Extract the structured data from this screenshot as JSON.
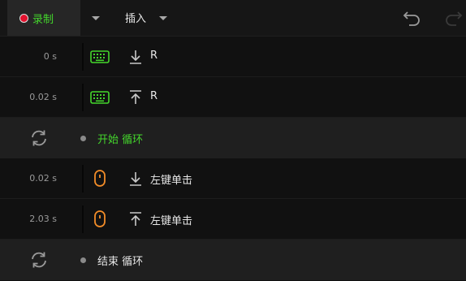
{
  "toolbar": {
    "record_label": "录制",
    "insert_label": "插入",
    "colors": {
      "accent": "#44d62c",
      "record_dot": "#e3112e"
    },
    "icons": [
      "record-dot-icon",
      "chevron-down-icon",
      "undo-icon",
      "redo-icon"
    ]
  },
  "rows": [
    {
      "type": "event",
      "time": "0 s",
      "device": "keyboard-icon",
      "direction": "down",
      "label": "R"
    },
    {
      "type": "event",
      "time": "0.02 s",
      "device": "keyboard-icon",
      "direction": "up",
      "label": "R"
    },
    {
      "type": "loop",
      "label": "开始 循环",
      "color": "#44d62c"
    },
    {
      "type": "event",
      "time": "0.02 s",
      "device": "mouse-icon",
      "direction": "down",
      "label": "左键单击"
    },
    {
      "type": "event",
      "time": "2.03 s",
      "device": "mouse-icon",
      "direction": "up",
      "label": "左键单击"
    },
    {
      "type": "loop",
      "label": "结束 循环",
      "color": "#e6e6e6"
    }
  ]
}
